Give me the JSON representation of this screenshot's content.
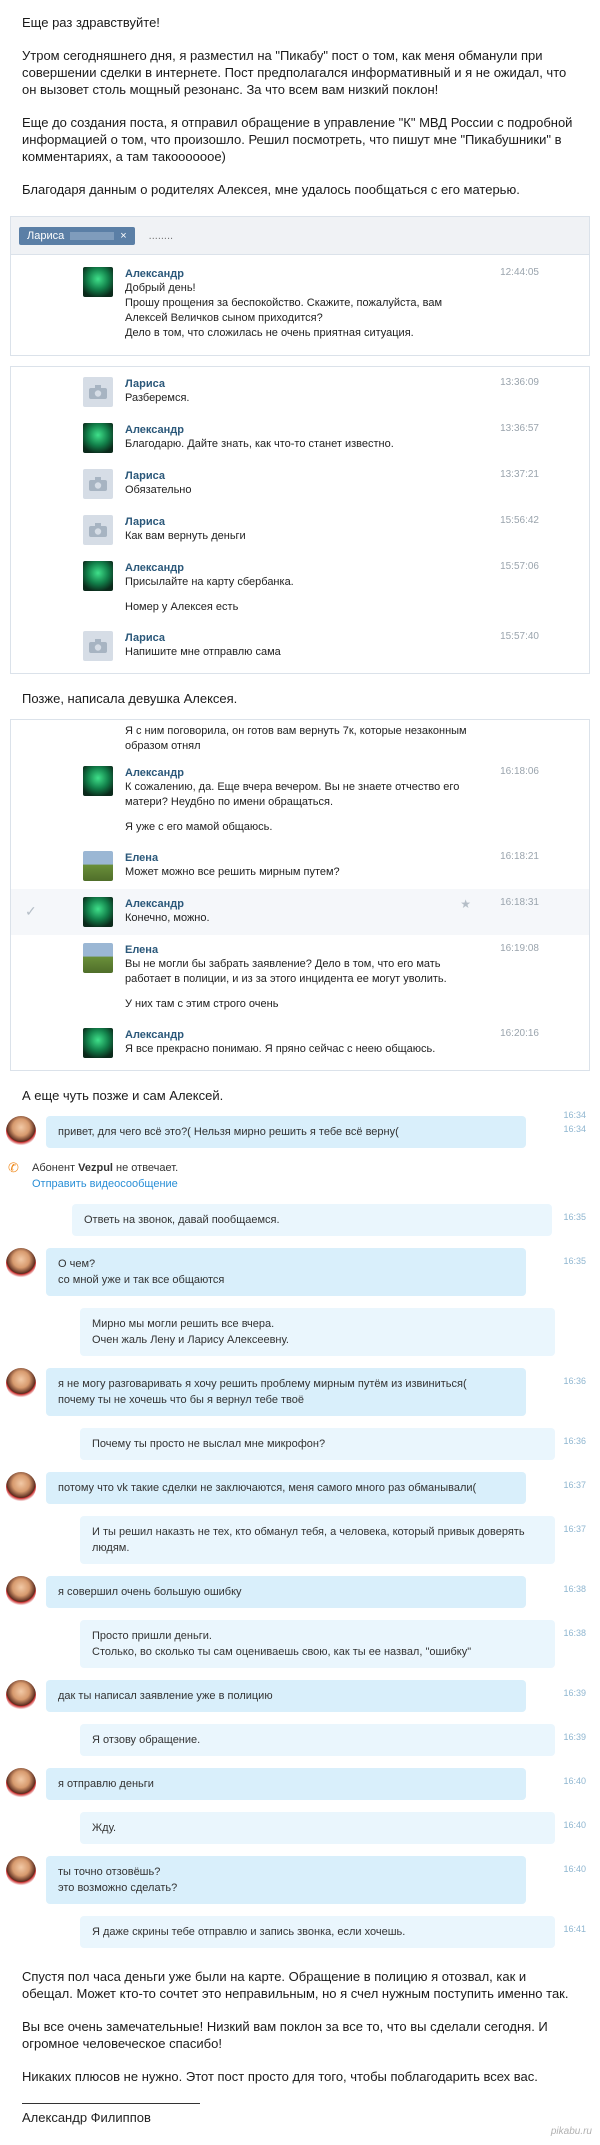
{
  "intro": [
    "Еще раз здравствуйте!",
    "Утром сегодняшнего дня, я разместил на \"Пикабу\" пост о том, как меня обманули при совершении сделки в интернете. Пост предполагался информативный и я не ожидал, что он вызовет столь мощный резонанс. За что всем вам низкий поклон!",
    "Еще до создания поста, я отправил обращение в управление \"К\" МВД России с подробной информацией о том, что произошло. Решил посмотреть, что пишут мне \"Пикабушники\" в комментариях, а там такоооооое)",
    "Благодаря данным о родителях Алексея, мне удалось пообщаться с его матерью."
  ],
  "vk1": {
    "tab_active": "Лариса",
    "tab_close": "×",
    "tab_other": "........",
    "messages": [
      {
        "name": "Александр",
        "time": "12:44:05",
        "lines": [
          "Добрый день!",
          "Прошу прощения за беспокойство. Скажите, пожалуйста, вам",
          "Алексей Величков сыном приходится?",
          "Дело в том, что сложилась не очень приятная ситуация."
        ]
      }
    ]
  },
  "vk2": {
    "messages": [
      {
        "name": "Лариса",
        "time": "13:36:09",
        "lines": [
          "Разберемся."
        ]
      },
      {
        "name": "Александр",
        "time": "13:36:57",
        "lines": [
          "Благодарю. Дайте знать, как что-то станет известно."
        ]
      },
      {
        "name": "Лариса",
        "time": "13:37:21",
        "lines": [
          "Обязательно"
        ]
      },
      {
        "name": "Лариса",
        "time": "15:56:42",
        "lines": [
          "Как вам вернуть деньги"
        ]
      },
      {
        "name": "Александр",
        "time": "15:57:06",
        "lines": [
          "Присылайте на карту сбербанка."
        ]
      },
      {
        "lines_extra": "Номер у Алексея есть"
      },
      {
        "name": "Лариса",
        "time": "15:57:40",
        "lines": [
          "Напишите мне отправлю сама"
        ]
      }
    ]
  },
  "mid1": "Позже, написала девушка Алексея.",
  "vk3": {
    "top_lines": [
      "Я с ним поговорила, он готов вам вернуть 7к, которые незаконным",
      "образом отнял"
    ],
    "messages": [
      {
        "name": "Александр",
        "time": "16:18:06",
        "lines": [
          "К сожалению, да. Еще вчера вечером. Вы не знаете отчество его",
          "матери? Неудбно по имени обращаться."
        ],
        "extra": "Я уже с его мамой общаюсь."
      },
      {
        "name": "Елена",
        "time": "16:18:21",
        "lines": [
          "Может можно все решить мирным путем?"
        ]
      },
      {
        "name": "Александр",
        "time": "16:18:31",
        "lines": [
          "Конечно, можно."
        ]
      },
      {
        "name": "Елена",
        "time": "16:19:08",
        "lines": [
          "Вы не могли бы забрать заявление? Дело в том, что его мать",
          "работает в полиции, и из за этого инцидента ее могут уволить."
        ],
        "extra": "У них там с этим строго очень"
      },
      {
        "name": "Александр",
        "time": "16:20:16",
        "lines": [
          "Я все прекрасно понимаю. Я пряно сейчас с неею общаюсь."
        ]
      }
    ]
  },
  "mid2": "А еще чуть позже и сам Алексей.",
  "skype": {
    "call_prefix": "Абонент ",
    "call_name": "Vezpul",
    "call_suffix": " не отвечает.",
    "call_link": "Отправить видеосообщение",
    "call_time": "16:34",
    "messages": [
      {
        "dir": "in",
        "time": "16:34",
        "lines": [
          "привет, для чего всё это?( Нельзя мирно решить я тебе всё верну("
        ]
      },
      {
        "dir": "out",
        "time": "16:35",
        "lines": [
          "Ответь на звонок, давай пообщаемся."
        ]
      },
      {
        "dir": "in",
        "time": "16:35",
        "lines": [
          "О чем?",
          "со мной уже и так все общаются"
        ]
      },
      {
        "dir": "out",
        "time": "",
        "lines": [
          "Мирно мы могли решить все вчера.",
          "Очен жаль Лену и Ларису Алексеевну."
        ]
      },
      {
        "dir": "in",
        "time": "16:36",
        "lines": [
          "я не могу разговаривать я хочу решить проблему мирным путём из извиниться(",
          "почему ты не хочешь что бы я вернул тебе твоё"
        ]
      },
      {
        "dir": "out",
        "time": "16:36",
        "lines": [
          "Почему ты просто не выслал мне микрофон?"
        ]
      },
      {
        "dir": "in",
        "time": "16:37",
        "lines": [
          "потому что vk такие сделки не заключаются, меня самого много раз обманывали("
        ]
      },
      {
        "dir": "out",
        "time": "16:37",
        "lines": [
          "И ты решил наказть не тех, кто обманул тебя, а человека, который привык доверять",
          "людям."
        ]
      },
      {
        "dir": "in",
        "time": "16:38",
        "lines": [
          "я совершил очень большую ошибку"
        ]
      },
      {
        "dir": "out",
        "time": "16:38",
        "lines": [
          "Просто пришли деньги.",
          "Столько, во сколько ты сам оцениваешь свою, как ты ее назвал, \"ошибку\""
        ]
      },
      {
        "dir": "in",
        "time": "16:39",
        "lines": [
          "дак ты написал заявление уже в полицию"
        ]
      },
      {
        "dir": "out",
        "time": "16:39",
        "lines": [
          "Я отзову обращение."
        ]
      },
      {
        "dir": "in",
        "time": "16:40",
        "lines": [
          "я отправлю деньги"
        ]
      },
      {
        "dir": "out",
        "time": "16:40",
        "lines": [
          "Жду."
        ]
      },
      {
        "dir": "in",
        "time": "16:40",
        "lines": [
          "ты точно отзовёшь?",
          "это возможно сделать?"
        ]
      },
      {
        "dir": "out",
        "time": "16:41",
        "lines": [
          "Я даже скрины тебе отправлю и запись звонка, если хочешь."
        ]
      }
    ]
  },
  "outro": [
    "Спустя пол часа деньги уже были на карте. Обращение в полицию я отозвал, как и обещал. Может кто-то сочтет это неправильным, но я счел нужным поступить именно так.",
    "Вы все очень замечательные! Низкий вам поклон за все то, что вы сделали сегодня. И огромное человеческое спасибо!",
    "Никаких плюсов не нужно. Этот пост просто для того, чтобы поблагодарить всех вас."
  ],
  "signature": "Александр Филиппов",
  "watermark": "pikabu.ru"
}
